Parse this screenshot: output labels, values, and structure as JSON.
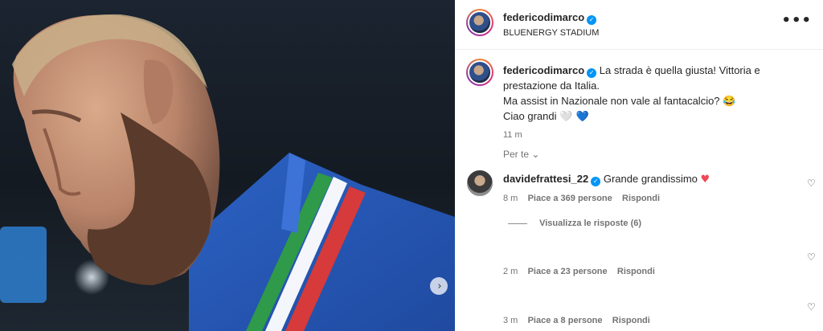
{
  "post": {
    "author": "federicodimarco",
    "location": "BLUENERGY STADIUM",
    "caption_line1": "La strada è quella giusta! Vittoria e",
    "caption_line2": "prestazione da Italia.",
    "caption_line3": "Ma assist in Nazionale non vale al fantacalcio? 😂",
    "caption_line4": "Ciao grandi",
    "caption_emoji": "🤍 💙",
    "time": "11 m",
    "more_icon": "more-options-icon",
    "verified_mark": "✓"
  },
  "filter": {
    "label": "Per te",
    "chevron": "⌄"
  },
  "comments": [
    {
      "author": "davidefrattesi_22",
      "text": "Grande grandissimo",
      "emoji": "♥",
      "time": "8 m",
      "likes": "Piace a 369 persone",
      "reply": "Rispondi"
    },
    {
      "author": "",
      "text": "",
      "time": "2 m",
      "likes": "Piace a 23 persone",
      "reply": "Rispondi"
    },
    {
      "author": "",
      "text": "",
      "time": "3 m",
      "likes": "Piace a 8 persone",
      "reply": "Rispondi"
    }
  ],
  "view_replies": "Visualizza le risposte (6)",
  "icons": {
    "heart_outline": "♡",
    "next": "›"
  },
  "colors": {
    "verified": "#0095f6",
    "like_red": "#ed4956",
    "jersey_blue": "#2b5fb8"
  }
}
